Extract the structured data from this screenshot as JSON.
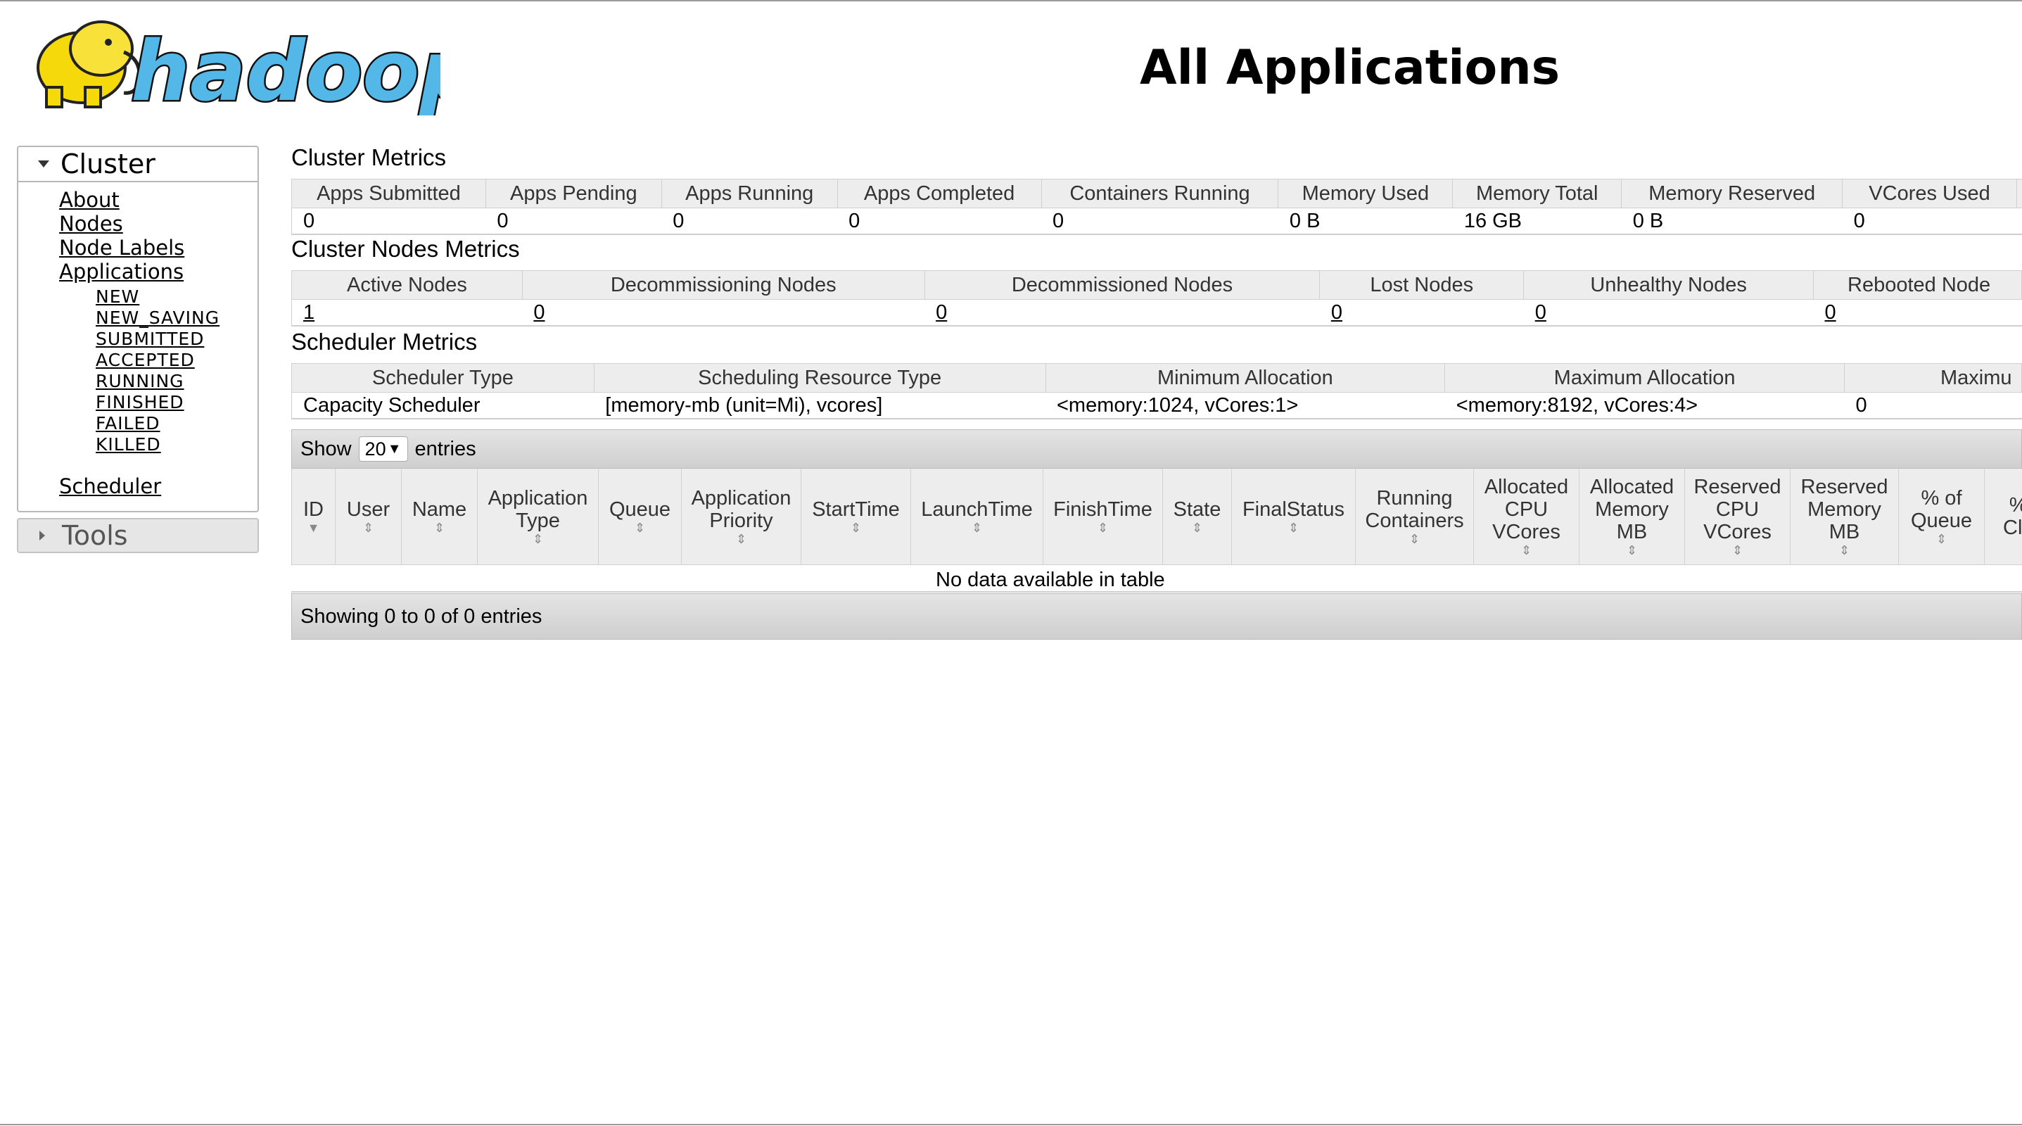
{
  "brand": {
    "logo_text": "hadoop"
  },
  "page_title": "All Applications",
  "sidebar": {
    "cluster_label": "Cluster",
    "links": [
      "About",
      "Nodes",
      "Node Labels",
      "Applications"
    ],
    "app_states": [
      "NEW",
      "NEW_SAVING",
      "SUBMITTED",
      "ACCEPTED",
      "RUNNING",
      "FINISHED",
      "FAILED",
      "KILLED"
    ],
    "scheduler_label": "Scheduler",
    "tools_label": "Tools"
  },
  "cluster_metrics": {
    "title": "Cluster Metrics",
    "headers": [
      "Apps Submitted",
      "Apps Pending",
      "Apps Running",
      "Apps Completed",
      "Containers Running",
      "Memory Used",
      "Memory Total",
      "Memory Reserved",
      "VCores Used"
    ],
    "values": [
      "0",
      "0",
      "0",
      "0",
      "0",
      "0 B",
      "16 GB",
      "0 B",
      "0"
    ]
  },
  "cluster_nodes_metrics": {
    "title": "Cluster Nodes Metrics",
    "headers": [
      "Active Nodes",
      "Decommissioning Nodes",
      "Decommissioned Nodes",
      "Lost Nodes",
      "Unhealthy Nodes",
      "Rebooted Node"
    ],
    "values": [
      "1",
      "0",
      "0",
      "0",
      "0",
      "0"
    ]
  },
  "scheduler_metrics": {
    "title": "Scheduler Metrics",
    "headers": [
      "Scheduler Type",
      "Scheduling Resource Type",
      "Minimum Allocation",
      "Maximum Allocation",
      "Maximu"
    ],
    "values": [
      "Capacity Scheduler",
      "[memory-mb (unit=Mi), vcores]",
      "<memory:1024, vCores:1>",
      "<memory:8192, vCores:4>",
      "0"
    ]
  },
  "apps_table": {
    "show_label": "Show",
    "page_size": "20",
    "entries_label": "entries",
    "columns": [
      "ID",
      "User",
      "Name",
      "Application\nType",
      "Queue",
      "Application\nPriority",
      "StartTime",
      "LaunchTime",
      "FinishTime",
      "State",
      "FinalStatus",
      "Running\nContainers",
      "Allocated\nCPU\nVCores",
      "Allocated\nMemory\nMB",
      "Reserved\nCPU\nVCores",
      "Reserved\nMemory\nMB",
      "% of\nQueue",
      "%\nClu"
    ],
    "empty_message": "No data available in table",
    "info": "Showing 0 to 0 of 0 entries"
  }
}
